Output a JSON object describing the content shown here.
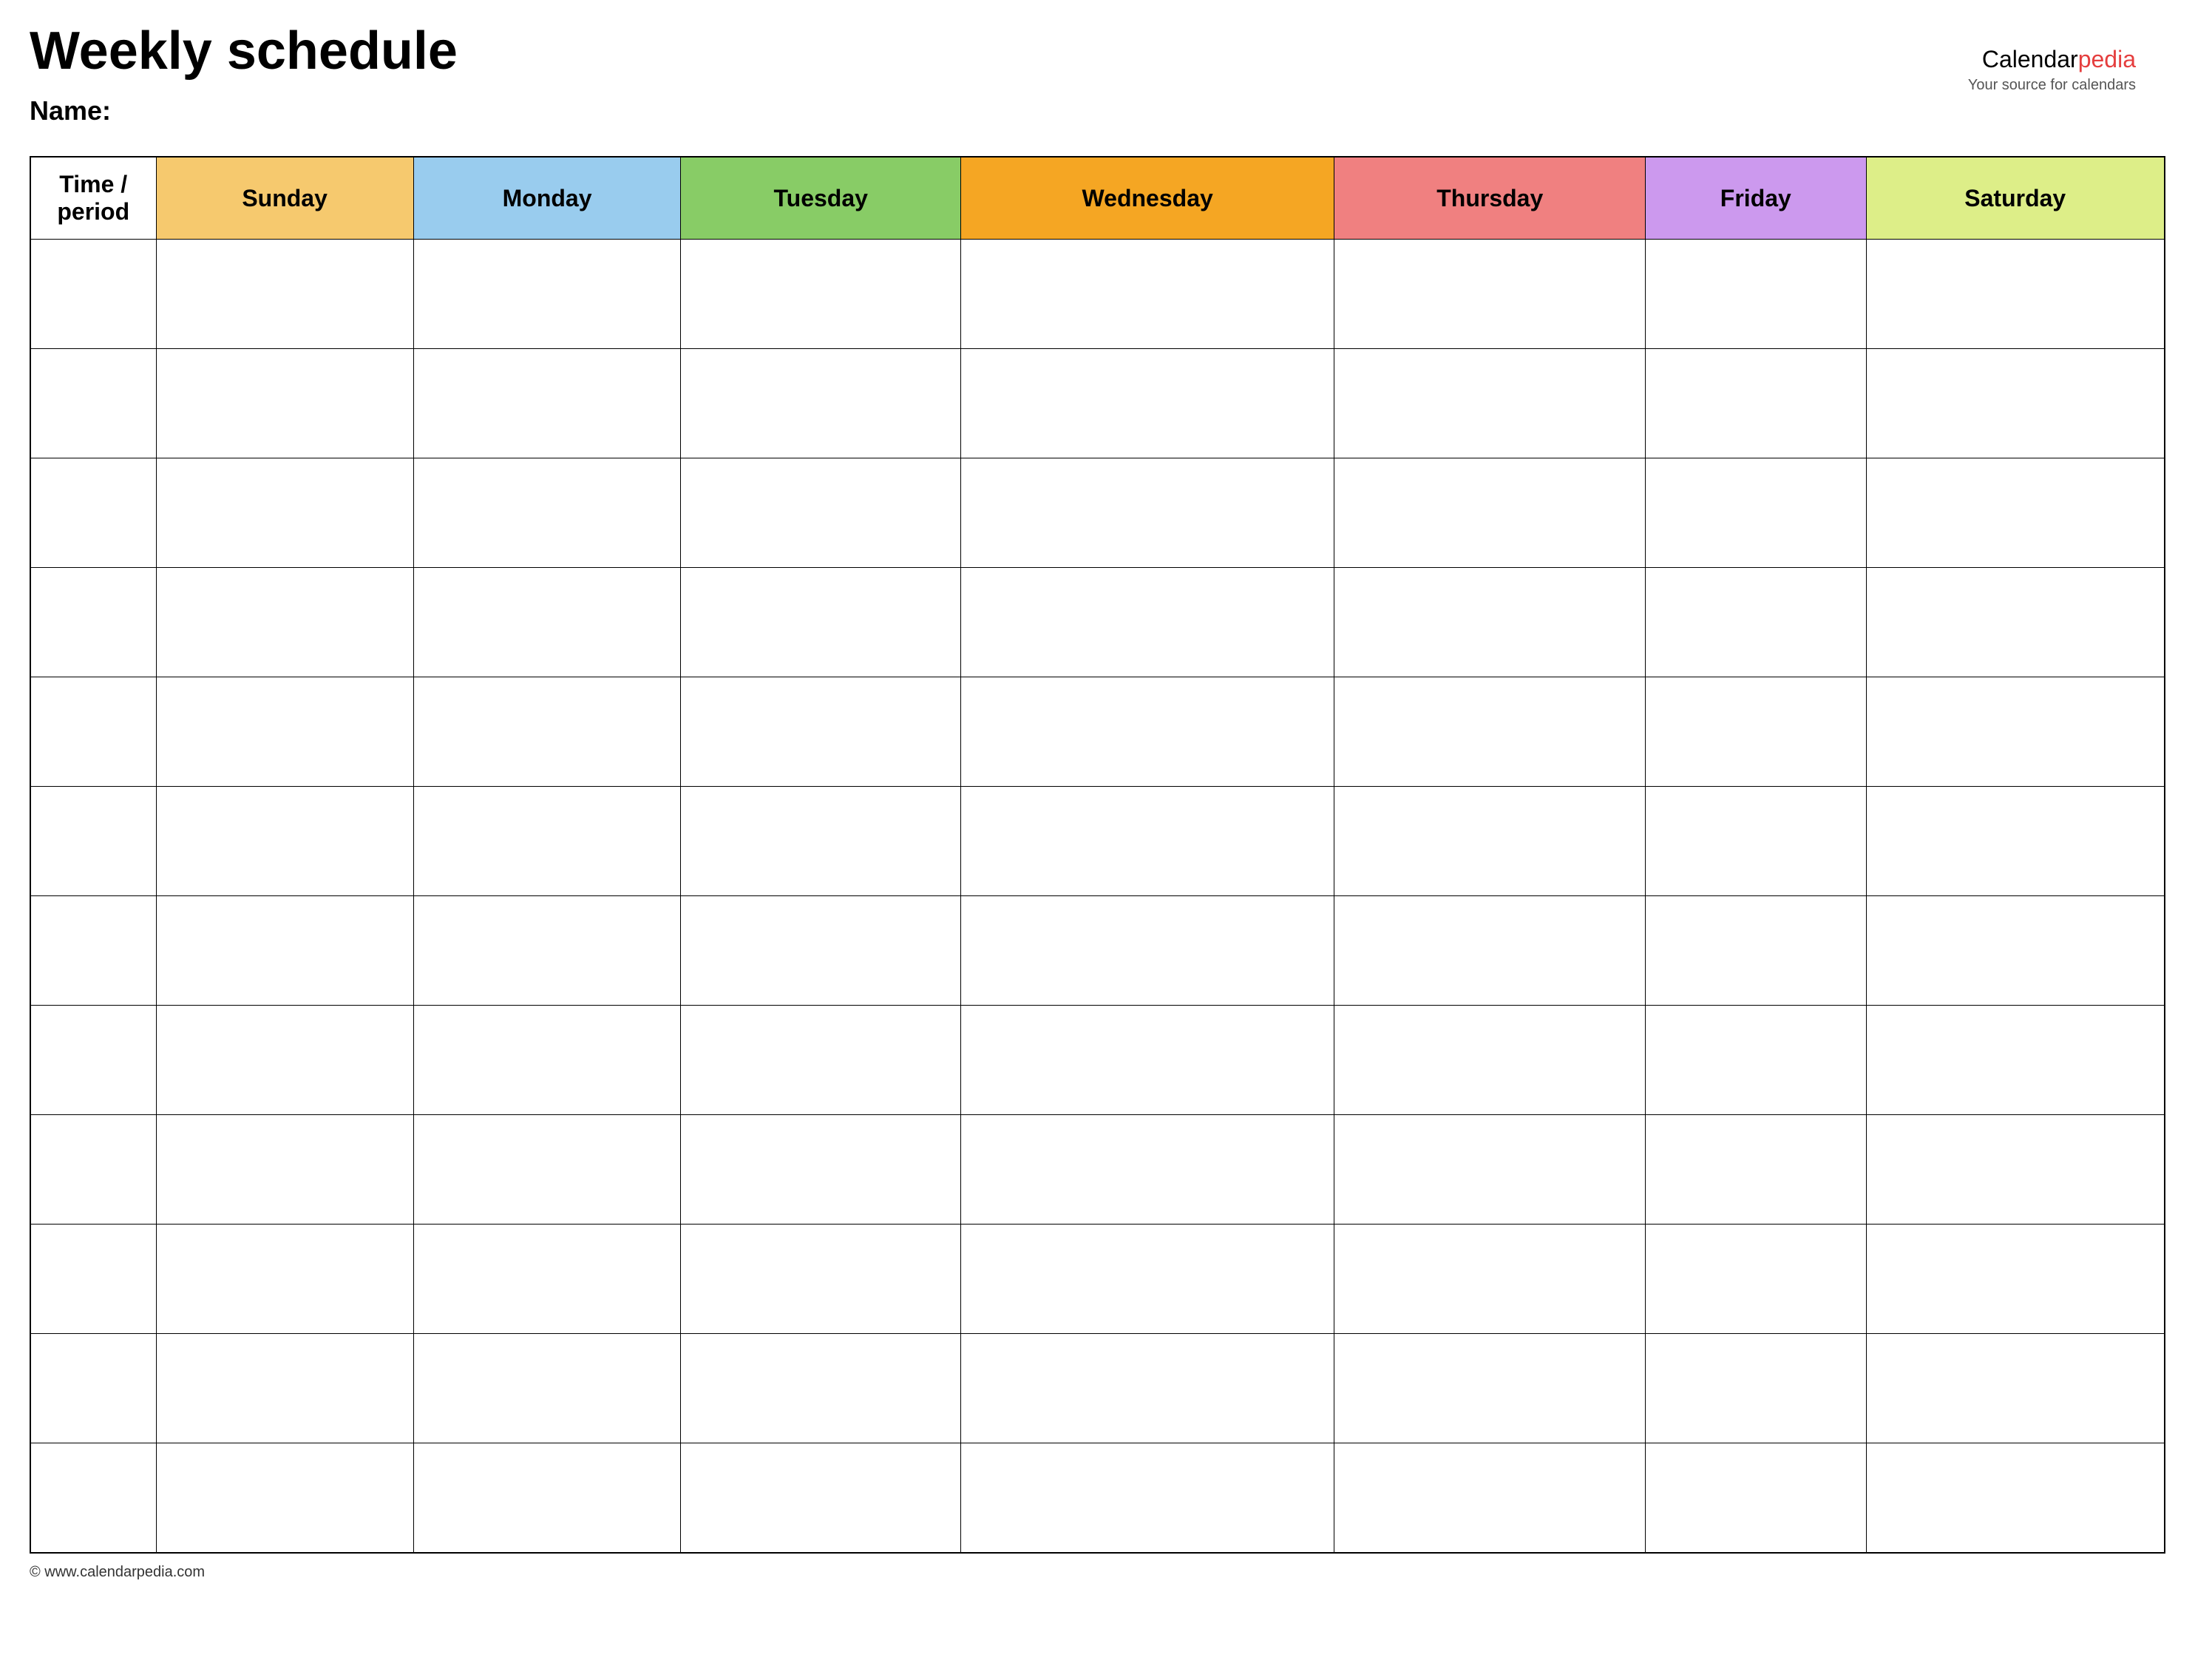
{
  "page": {
    "title": "Weekly schedule",
    "name_label": "Name:"
  },
  "brand": {
    "calendar": "Calendar",
    "pedia": "pedia",
    "tagline": "Your source for calendars"
  },
  "table": {
    "headers": [
      {
        "label": "Time / period",
        "class": "col-time"
      },
      {
        "label": "Sunday",
        "class": "col-sunday"
      },
      {
        "label": "Monday",
        "class": "col-monday"
      },
      {
        "label": "Tuesday",
        "class": "col-tuesday"
      },
      {
        "label": "Wednesday",
        "class": "col-wednesday"
      },
      {
        "label": "Thursday",
        "class": "col-thursday"
      },
      {
        "label": "Friday",
        "class": "col-friday"
      },
      {
        "label": "Saturday",
        "class": "col-saturday"
      }
    ],
    "row_count": 12
  },
  "footer": {
    "url": "© www.calendarpedia.com"
  }
}
